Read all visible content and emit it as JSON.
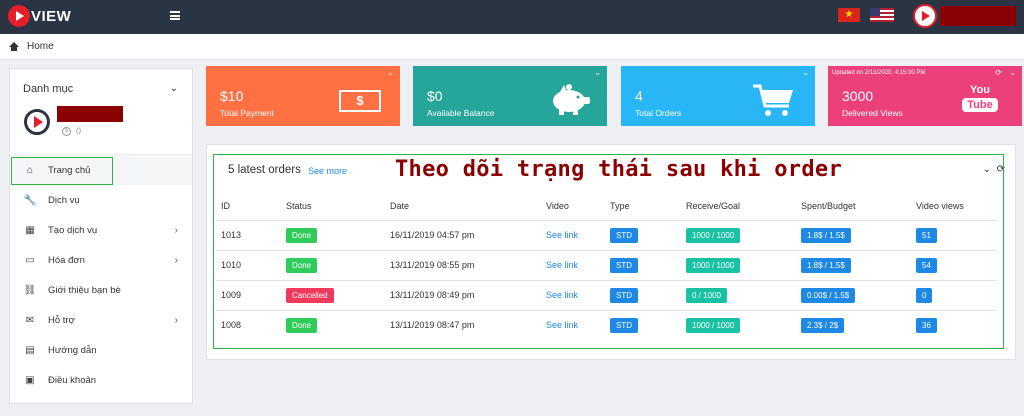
{
  "app": {
    "logo_text": "VIEW",
    "vn_star": "★"
  },
  "breadcrumb": {
    "home": "Home"
  },
  "sidebar": {
    "heading": "Danh mục",
    "balance": "0",
    "coin_symbol": "$",
    "items": [
      {
        "label": "Trang chủ",
        "icon": "home-icon",
        "glyph": "⌂",
        "arrow": ""
      },
      {
        "label": "Dịch vụ",
        "icon": "wrench-icon",
        "glyph": "🔧",
        "arrow": ""
      },
      {
        "label": "Tạo dịch vụ",
        "icon": "store-icon",
        "glyph": "▦",
        "arrow": "›"
      },
      {
        "label": "Hóa đơn",
        "icon": "credit-card-icon",
        "glyph": "▭",
        "arrow": "›"
      },
      {
        "label": "Giới thiệu bạn bè",
        "icon": "link-icon",
        "glyph": "⛓",
        "arrow": ""
      },
      {
        "label": "Hỗ trợ",
        "icon": "chat-icon",
        "glyph": "✉",
        "arrow": "›"
      },
      {
        "label": "Hướng dẫn",
        "icon": "book-icon",
        "glyph": "▤",
        "arrow": ""
      },
      {
        "label": "Điều khoản",
        "icon": "clipboard-icon",
        "glyph": "▣",
        "arrow": ""
      }
    ]
  },
  "cards": {
    "payment": {
      "value": "$10",
      "label": "Total Payment",
      "icon_text": "$"
    },
    "balance": {
      "value": "$0",
      "label": "Available Balance"
    },
    "orders": {
      "value": "4",
      "label": "Total Orders"
    },
    "views": {
      "value": "3000",
      "label": "Delivered Views",
      "updated": "Updated on 2/13/2020, 4:15:00 PM",
      "yt_you": "You",
      "yt_tube": "Tube"
    }
  },
  "orders": {
    "title": "5 latest orders",
    "see_more": "See more",
    "overlay_note": "Theo dõi trạng thái sau khi order",
    "columns": [
      "ID",
      "Status",
      "Date",
      "Video",
      "Type",
      "Receive/Goal",
      "Spent/Budget",
      "Video views"
    ],
    "rows": [
      {
        "id": "1013",
        "status": "Done",
        "date": "16/11/2019 04:57 pm",
        "video": "See link",
        "type": "STD",
        "receive": "1000 / 1000",
        "spent": "1.8$ / 1.5$",
        "views": "51"
      },
      {
        "id": "1010",
        "status": "Done",
        "date": "13/11/2019 08:55 pm",
        "video": "See link",
        "type": "STD",
        "receive": "1000 / 1000",
        "spent": "1.8$ / 1.5$",
        "views": "54"
      },
      {
        "id": "1009",
        "status": "Cancelled",
        "date": "13/11/2019 08:49 pm",
        "video": "See link",
        "type": "STD",
        "receive": "0 / 1000",
        "spent": "0.00$ / 1.5$",
        "views": "0"
      },
      {
        "id": "1008",
        "status": "Done",
        "date": "13/11/2019 08:47 pm",
        "video": "See link",
        "type": "STD",
        "receive": "1000 / 1000",
        "spent": "2.3$ / 2$",
        "views": "36"
      }
    ]
  },
  "colors": {
    "topbar": "#2b3443",
    "card_payment": "#ff7043",
    "card_balance": "#26a69a",
    "card_orders": "#29b6f6",
    "card_views": "#ec407a",
    "done": "#2fcc5b",
    "cancelled": "#f0395c",
    "highlight": "#2fb34a"
  }
}
